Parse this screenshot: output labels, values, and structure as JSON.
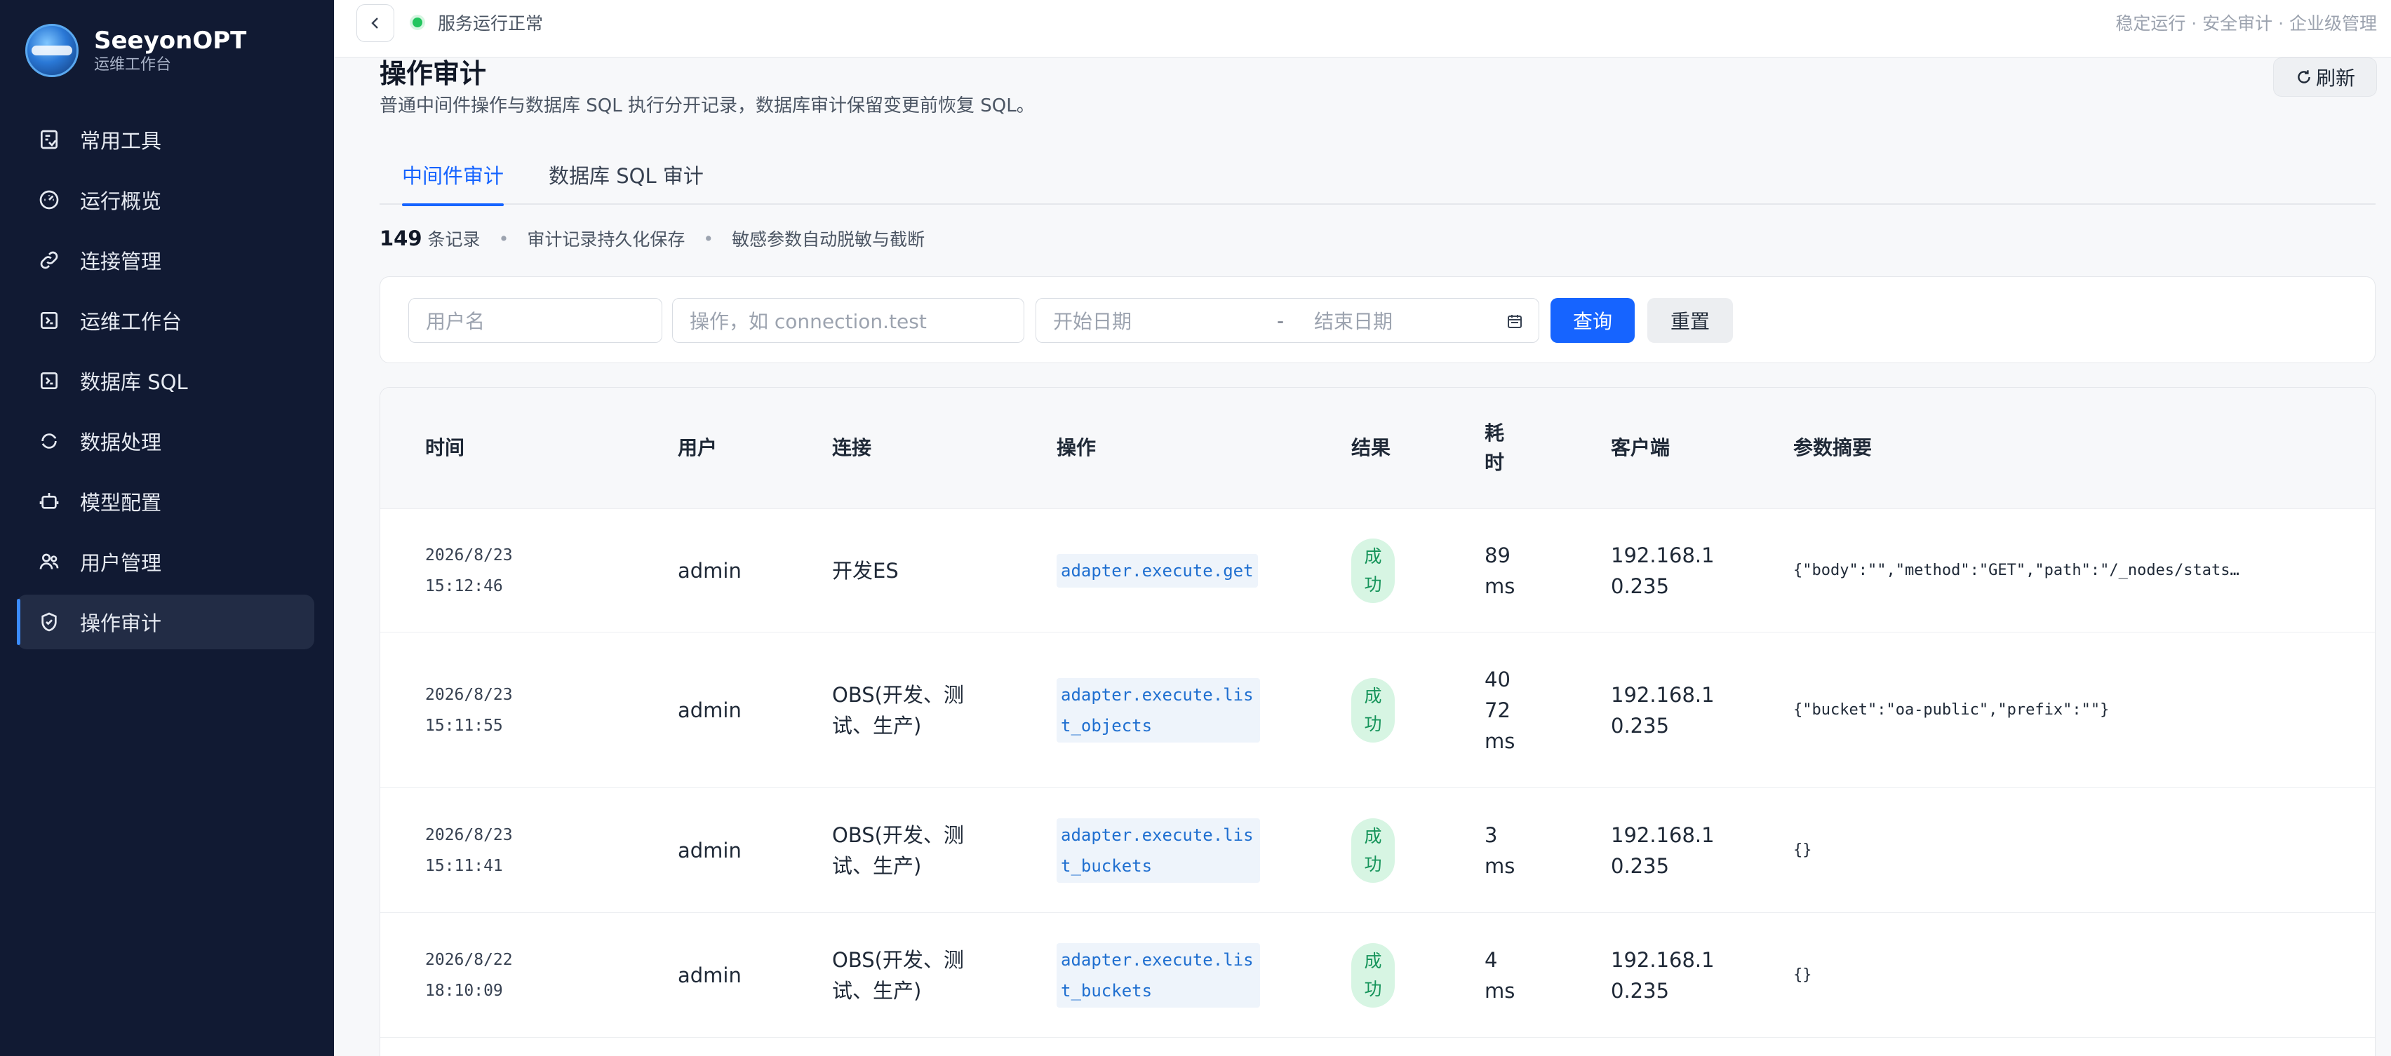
{
  "brand": {
    "title": "SeeyonOPT",
    "subtitle": "运维工作台"
  },
  "sidebar": {
    "items": [
      {
        "label": "常用工具",
        "icon": "toolbox-icon"
      },
      {
        "label": "运行概览",
        "icon": "dashboard-icon"
      },
      {
        "label": "连接管理",
        "icon": "link-icon"
      },
      {
        "label": "运维工作台",
        "icon": "terminal-icon"
      },
      {
        "label": "数据库 SQL",
        "icon": "database-icon"
      },
      {
        "label": "数据处理",
        "icon": "refresh-cycle-icon"
      },
      {
        "label": "模型配置",
        "icon": "robot-icon"
      },
      {
        "label": "用户管理",
        "icon": "users-icon"
      },
      {
        "label": "操作审计",
        "icon": "shield-check-icon",
        "active": true
      }
    ]
  },
  "topbar": {
    "status": "服务运行正常",
    "right_text": "稳定运行 · 安全审计 · 企业级管理"
  },
  "page": {
    "title": "操作审计",
    "description": "普通中间件操作与数据库 SQL 执行分开记录，数据库审计保留变更前恢复 SQL。",
    "refresh_label": "刷新"
  },
  "tabs": [
    {
      "label": "中间件审计",
      "active": true
    },
    {
      "label": "数据库 SQL 审计",
      "active": false
    }
  ],
  "summary": {
    "count": "149",
    "count_unit": "条记录",
    "note1": "审计记录持久化保存",
    "note2": "敏感参数自动脱敏与截断"
  },
  "filters": {
    "username_placeholder": "用户名",
    "operation_placeholder": "操作，如 connection.test",
    "start_date_placeholder": "开始日期",
    "date_separator": "-",
    "end_date_placeholder": "结束日期",
    "query_label": "查询",
    "reset_label": "重置"
  },
  "table": {
    "headers": {
      "time": "时间",
      "user": "用户",
      "connection": "连接",
      "operation": "操作",
      "result": "结果",
      "duration": "耗时",
      "client": "客户端",
      "params": "参数摘要"
    },
    "rows": [
      {
        "time": "2026/8/23 15:12:46",
        "user": "admin",
        "connection": "开发ES",
        "operation": "adapter.execute.get",
        "result": "成功",
        "duration": "89 ms",
        "client": "192.168.10.235",
        "params": "{\"body\":\"\",\"method\":\"GET\",\"path\":\"/_nodes/stats…"
      },
      {
        "time": "2026/8/23 15:11:55",
        "user": "admin",
        "connection": "OBS(开发、测试、生产)",
        "operation": "adapter.execute.list_objects",
        "result": "成功",
        "duration": "4072 ms",
        "client": "192.168.10.235",
        "params": "{\"bucket\":\"oa-public\",\"prefix\":\"\"}"
      },
      {
        "time": "2026/8/23 15:11:41",
        "user": "admin",
        "connection": "OBS(开发、测试、生产)",
        "operation": "adapter.execute.list_buckets",
        "result": "成功",
        "duration": "3 ms",
        "client": "192.168.10.235",
        "params": "{}"
      },
      {
        "time": "2026/8/22 18:10:09",
        "user": "admin",
        "connection": "OBS(开发、测试、生产)",
        "operation": "adapter.execute.list_buckets",
        "result": "成功",
        "duration": "4 ms",
        "client": "192.168.10.235",
        "params": "{}"
      }
    ]
  },
  "colors": {
    "sidebar_bg": "#111a33",
    "accent": "#1664ff",
    "success_bg": "#d7f5e3",
    "success_text": "#15945a"
  }
}
